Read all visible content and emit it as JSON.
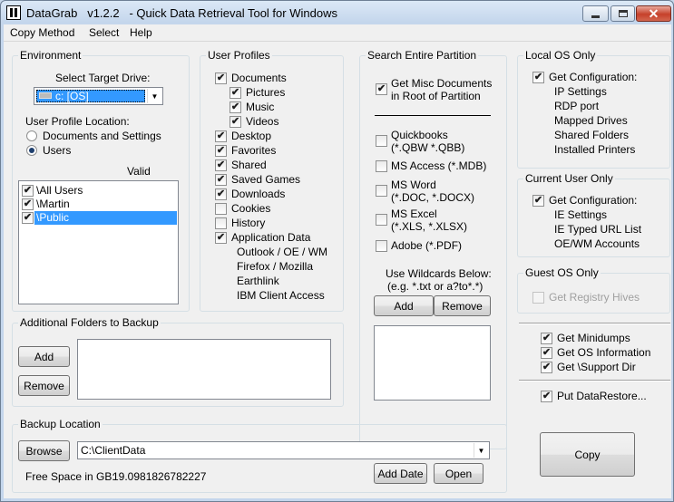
{
  "window": {
    "app_name": "DataGrab",
    "title": "DataGrab   v1.2.2   - Quick Data Retrieval Tool for Windows",
    "close_symbol": "✕"
  },
  "menu": [
    "Copy Method",
    "Select",
    "Help"
  ],
  "environment": {
    "title": "Environment",
    "target_drive_label": "Select Target Drive:",
    "target_drive_value": "c: [OS]",
    "profile_location_label": "User Profile Location:",
    "options": [
      {
        "label": "Documents and Settings",
        "selected": false
      },
      {
        "label": "Users",
        "selected": true
      }
    ],
    "valid_label": "Valid",
    "profiles": [
      {
        "label": "\\All Users",
        "checked": true,
        "selected": false
      },
      {
        "label": "\\Martin",
        "checked": true,
        "selected": false
      },
      {
        "label": "\\Public",
        "checked": true,
        "selected": true
      }
    ]
  },
  "user_profiles": {
    "title": "User Profiles",
    "items": [
      {
        "label": "Documents",
        "checked": true,
        "indent": 0
      },
      {
        "label": "Pictures",
        "checked": true,
        "indent": 1
      },
      {
        "label": "Music",
        "checked": true,
        "indent": 1
      },
      {
        "label": "Videos",
        "checked": true,
        "indent": 1
      },
      {
        "label": "Desktop",
        "checked": true,
        "indent": 0
      },
      {
        "label": "Favorites",
        "checked": true,
        "indent": 0
      },
      {
        "label": "Shared",
        "checked": true,
        "indent": 0
      },
      {
        "label": "Saved Games",
        "checked": true,
        "indent": 0
      },
      {
        "label": "Downloads",
        "checked": true,
        "indent": 0
      },
      {
        "label": "Cookies",
        "checked": false,
        "indent": 0
      },
      {
        "label": "History",
        "checked": false,
        "indent": 0
      },
      {
        "label": "Application Data",
        "checked": true,
        "indent": 0
      }
    ],
    "app_data_subitems": [
      "Outlook / OE / WM",
      "Firefox / Mozilla",
      "Earthlink",
      "IBM Client Access"
    ]
  },
  "search_partition": {
    "title": "Search Entire Partition",
    "misc_docs": {
      "line1": "Get Misc Documents",
      "line2": "in Root of Partition",
      "checked": true
    },
    "file_types": [
      {
        "line1": "Quickbooks",
        "line2": "(*.QBW *.QBB)",
        "checked": false
      },
      {
        "line1": "MS Access (*.MDB)",
        "line2": "",
        "checked": false
      },
      {
        "line1": "MS Word",
        "line2": "(*.DOC, *.DOCX)",
        "checked": false
      },
      {
        "line1": "MS Excel",
        "line2": "(*.XLS, *.XLSX)",
        "checked": false
      },
      {
        "line1": "Adobe  (*.PDF)",
        "line2": "",
        "checked": false
      }
    ],
    "wildcard_label": "Use Wildcards Below:",
    "wildcard_example": "(e.g. *.txt or a?to*.*)",
    "add_label": "Add",
    "remove_label": "Remove"
  },
  "local_os": {
    "title": "Local OS Only",
    "get_config_label": "Get Configuration:",
    "checked": true,
    "items": [
      "IP Settings",
      "RDP port",
      "Mapped Drives",
      "Shared Folders",
      "Installed Printers"
    ]
  },
  "current_user": {
    "title": "Current User Only",
    "get_config_label": "Get Configuration:",
    "checked": true,
    "items": [
      "IE Settings",
      "IE Typed URL List",
      "OE/WM Accounts"
    ]
  },
  "guest_os": {
    "title": "Guest OS Only",
    "registry_label": "Get Registry Hives",
    "checked": false
  },
  "extras": [
    {
      "label": "Get Minidumps",
      "checked": true
    },
    {
      "label": "Get OS Information",
      "checked": true
    },
    {
      "label": "Get \\Support Dir",
      "checked": true
    }
  ],
  "put_restore": {
    "label": "Put DataRestore...",
    "checked": true
  },
  "additional_folders": {
    "title": "Additional Folders to Backup",
    "add_label": "Add",
    "remove_label": "Remove"
  },
  "backup_location": {
    "title": "Backup Location",
    "browse_label": "Browse",
    "path": "C:\\ClientData",
    "free_space_label": "Free Space in GB:",
    "free_space_value": "19.0981826782227",
    "add_date_label": "Add Date",
    "open_label": "Open"
  },
  "copy_label": "Copy"
}
